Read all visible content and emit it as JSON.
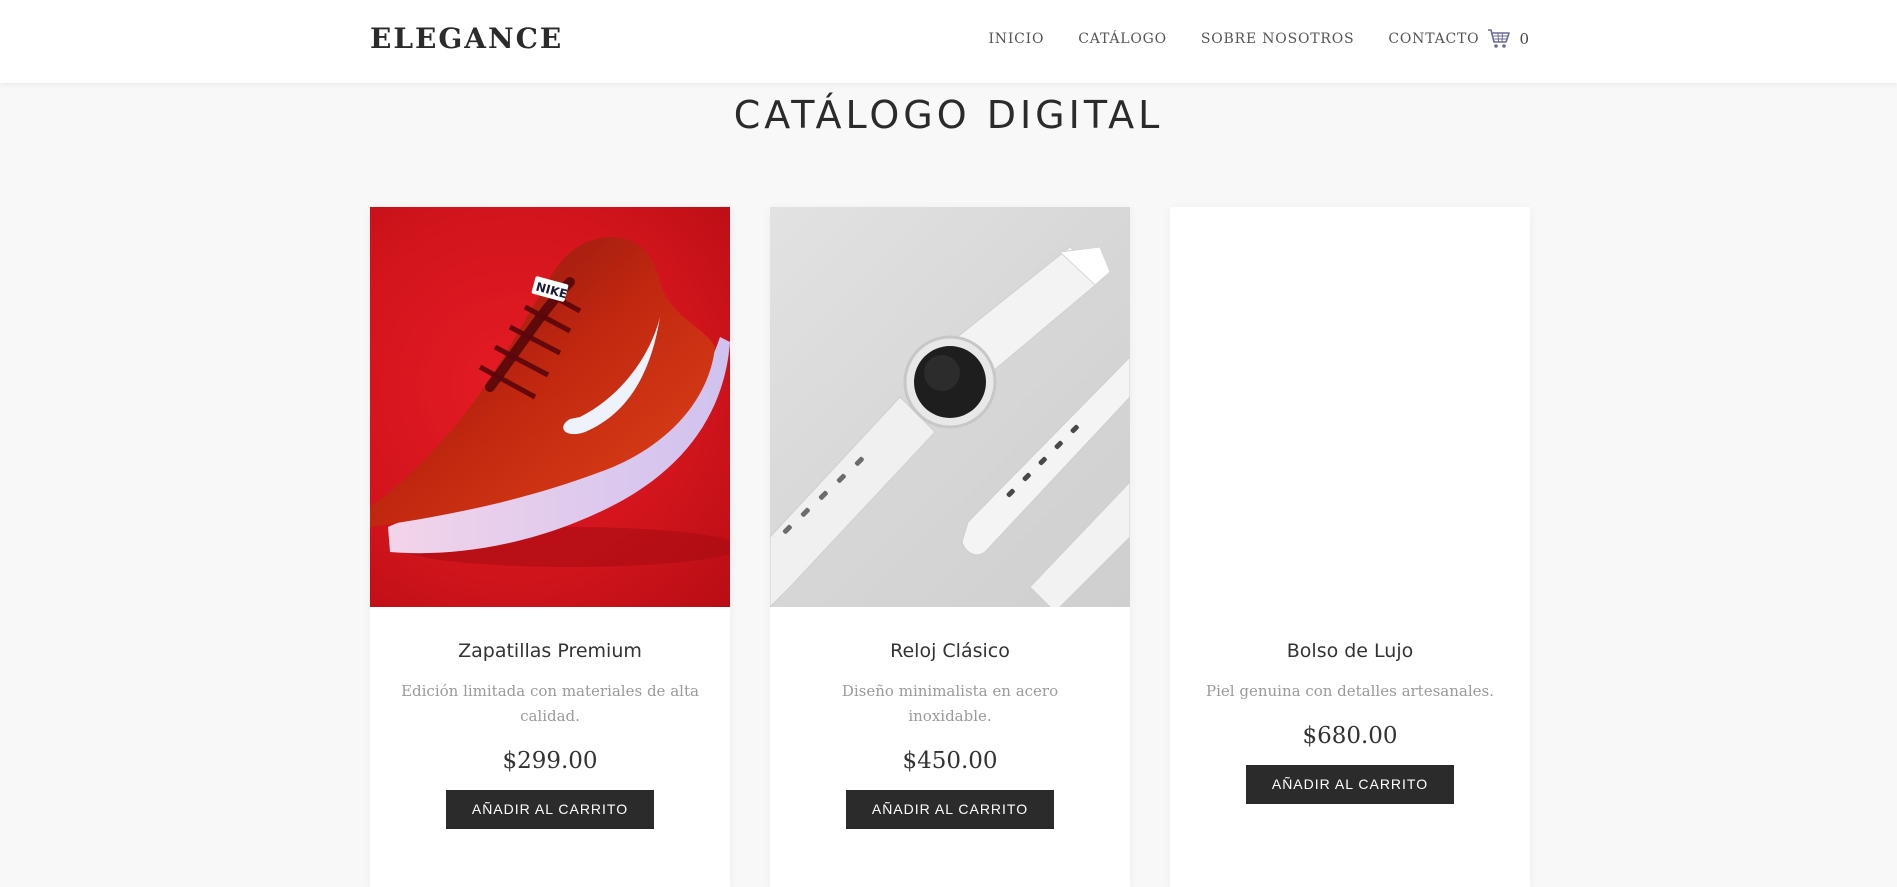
{
  "brand": "ELEGANCE",
  "nav": {
    "items": [
      "INICIO",
      "CATÁLOGO",
      "SOBRE NOSOTROS",
      "CONTACTO"
    ],
    "cart_icon": "shopping-cart-icon",
    "cart_count": "0"
  },
  "page_title": "CATÁLOGO DIGITAL",
  "products": [
    {
      "name": "Zapatillas Premium",
      "description": "Edición limitada con materiales de alta calidad.",
      "price": "$299.00",
      "button": "AÑADIR AL CARRITO",
      "image": "red-sneaker-photo"
    },
    {
      "name": "Reloj Clásico",
      "description": "Diseño minimalista en acero inoxidable.",
      "price": "$450.00",
      "button": "AÑADIR AL CARRITO",
      "image": "white-smartwatch-photo"
    },
    {
      "name": "Bolso de Lujo",
      "description": "Piel genuina con detalles artesanales.",
      "price": "$680.00",
      "button": "AÑADIR AL CARRITO",
      "image": "blank-image"
    }
  ],
  "colors": {
    "background": "#f8f8f8",
    "button": "#2b2b2b",
    "shoe_bg": "#d1141c",
    "watch_bg": "#d9d9d9"
  }
}
